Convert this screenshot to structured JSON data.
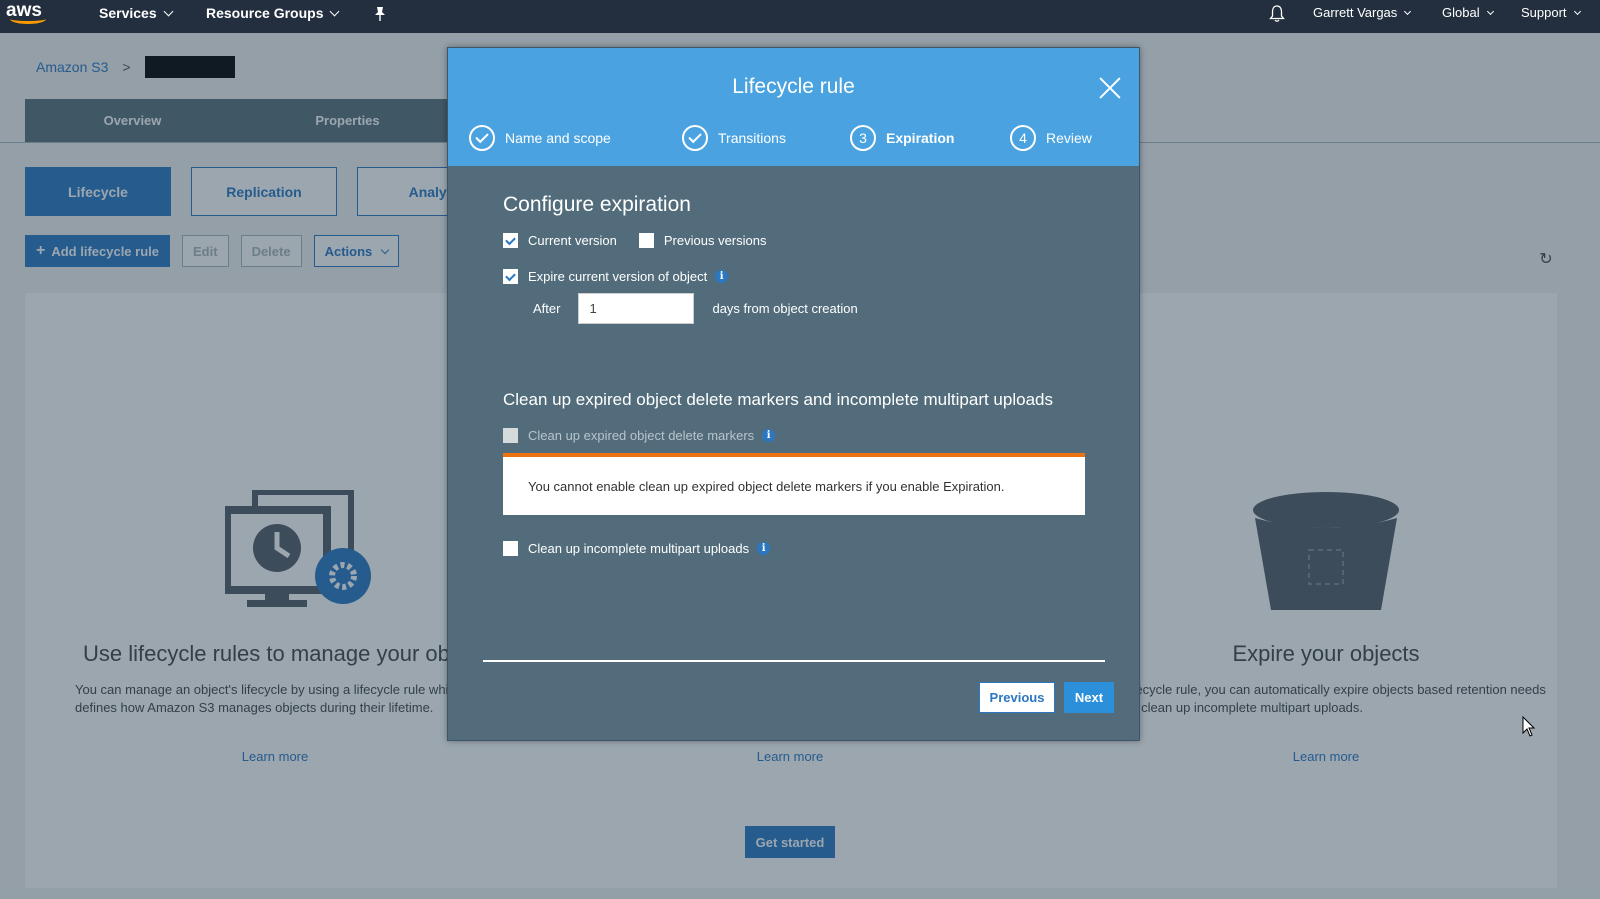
{
  "nav": {
    "logo": "aws",
    "services": "Services",
    "resource_groups": "Resource Groups",
    "user": "Garrett Vargas",
    "region": "Global",
    "support": "Support"
  },
  "breadcrumb": {
    "root": "Amazon S3",
    "separator": ">"
  },
  "tabs": [
    "Overview",
    "Properties"
  ],
  "subtabs": [
    "Lifecycle",
    "Replication",
    "Analyt"
  ],
  "toolbar": {
    "add": "Add lifecycle rule",
    "edit": "Edit",
    "delete": "Delete",
    "actions": "Actions"
  },
  "features": {
    "left": {
      "title": "Use lifecycle rules to manage your obje",
      "text": "You can manage an object's lifecycle by using a lifecycle rule which defines how Amazon S3 manages objects during their lifetime.",
      "learn": "Learn more"
    },
    "middle": {
      "learn": "Learn more"
    },
    "right": {
      "title": "Expire your objects",
      "text": "lifecycle rule, you can automatically expire objects based retention needs or clean up incomplete multipart uploads.",
      "learn": "Learn more"
    },
    "get_started": "Get started"
  },
  "modal": {
    "title": "Lifecycle rule",
    "steps": [
      {
        "number": "1",
        "label": "Name and scope",
        "state": "done"
      },
      {
        "number": "2",
        "label": "Transitions",
        "state": "done"
      },
      {
        "number": "3",
        "label": "Expiration",
        "state": "current"
      },
      {
        "number": "4",
        "label": "Review",
        "state": "todo"
      }
    ],
    "heading": "Configure expiration",
    "current_version": {
      "label": "Current version",
      "checked": true
    },
    "previous_versions": {
      "label": "Previous versions",
      "checked": false
    },
    "expire_current": {
      "label": "Expire current version of object",
      "checked": true
    },
    "after_label": "After",
    "days_value": "1",
    "days_suffix": "days from object creation",
    "cleanup_heading": "Clean up expired object delete markers and incomplete multipart uploads",
    "cleanup_markers": {
      "label": "Clean up expired object delete markers",
      "checked": false,
      "disabled": true
    },
    "warning": "You cannot enable clean up expired object delete markers if you enable Expiration.",
    "cleanup_multipart": {
      "label": "Clean up incomplete multipart uploads",
      "checked": false
    },
    "previous_button": "Previous",
    "next_button": "Next"
  },
  "colors": {
    "nav_bg": "#232f3e",
    "modal_header": "#4aa3e0",
    "modal_body": "#526c7b",
    "primary": "#2b77c1",
    "warning_accent": "#ec7211"
  }
}
